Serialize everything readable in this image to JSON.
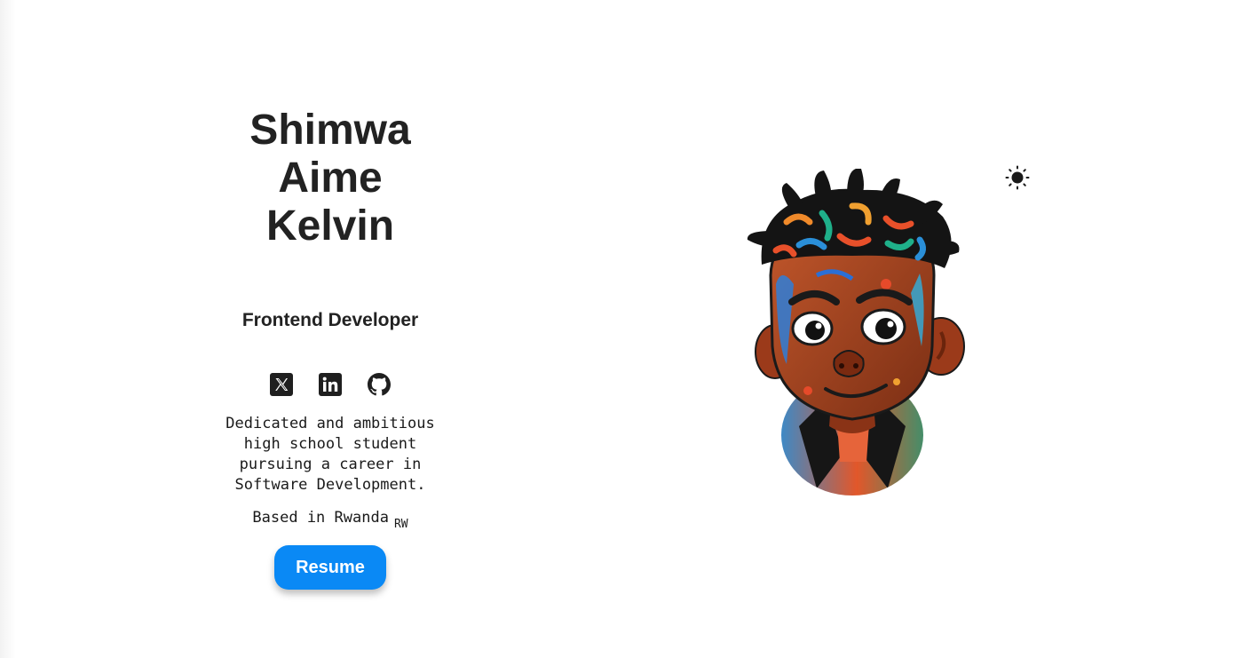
{
  "profile": {
    "name_lines": [
      "Shimwa",
      "Aime",
      "Kelvin"
    ],
    "role": "Frontend Developer",
    "bio": [
      "Dedicated and ambitious",
      "high school student",
      "pursuing a career in",
      "Software Development."
    ],
    "location": "Based in Rwanda",
    "flag_code": "RW"
  },
  "socials": [
    {
      "icon": "x-twitter-icon"
    },
    {
      "icon": "linkedin-icon"
    },
    {
      "icon": "github-icon"
    }
  ],
  "resume_label": "Resume",
  "theme_icon": "sun-icon",
  "colors": {
    "accent": "#0a89f5",
    "text": "#222222",
    "background": "#ffffff"
  }
}
